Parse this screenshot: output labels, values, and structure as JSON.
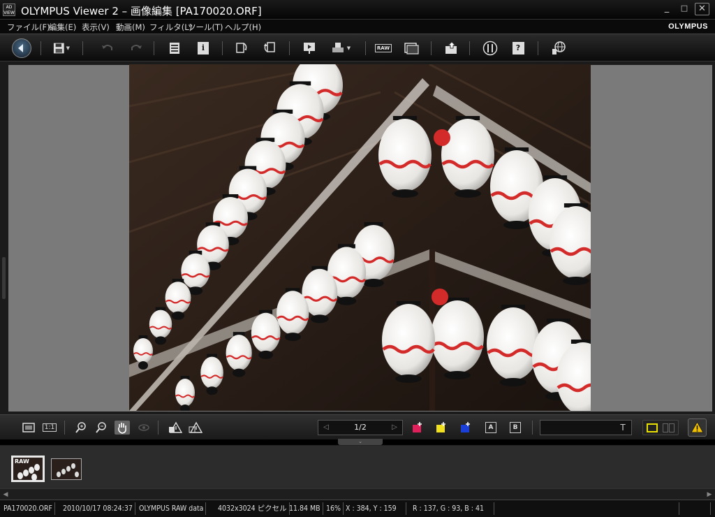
{
  "window": {
    "title": "OLYMPUS Viewer 2 – 画像編集 [PA170020.ORF]",
    "app_icon_text": "AD VIEW",
    "controls": {
      "minimize": "_",
      "maximize": "□",
      "close": "✕"
    }
  },
  "menu": {
    "items": [
      "ファイル(F)",
      "編集(E)",
      "表示(V)",
      "動画(M)",
      "フィルタ(L)",
      "ツール(T)",
      "ヘルプ(H)"
    ],
    "brand": "OLYMPUS"
  },
  "toolbar": {
    "buttons": [
      {
        "name": "back-button",
        "icon": "arrow-left-circle-icon"
      },
      {
        "name": "save-button",
        "icon": "floppy-icon"
      },
      {
        "name": "undo-button",
        "icon": "undo-icon"
      },
      {
        "name": "redo-button",
        "icon": "redo-icon"
      },
      {
        "name": "list-button",
        "icon": "list-icon"
      },
      {
        "name": "info-button",
        "icon": "info-icon",
        "label": "i"
      },
      {
        "name": "rotate-button",
        "icon": "rotate-icon"
      },
      {
        "name": "transform-button",
        "icon": "transform-icon"
      },
      {
        "name": "slideshow-button",
        "icon": "slideshow-icon"
      },
      {
        "name": "print-button",
        "icon": "printer-icon"
      },
      {
        "name": "raw-develop-button",
        "icon": "raw-icon",
        "label": "RAW"
      },
      {
        "name": "batch-raw-button",
        "icon": "batch-raw-icon"
      },
      {
        "name": "export-button",
        "icon": "export-icon"
      },
      {
        "name": "settings-button",
        "icon": "tools-icon"
      },
      {
        "name": "help-button",
        "icon": "help-icon",
        "label": "?"
      },
      {
        "name": "web-button",
        "icon": "globe-icon"
      }
    ]
  },
  "viewer": {
    "page_indicator": "1/2",
    "text_field_value": ""
  },
  "filmstrip": {
    "thumbnails": [
      {
        "tag": "RAW",
        "selected": true
      },
      {
        "tag": "",
        "selected": false
      }
    ]
  },
  "status": {
    "filename": "PA170020.ORF",
    "datetime": "2010/10/17 08:24:37",
    "format": "OLYMPUS RAW data",
    "dimensions": "4032x3024 ピクセル",
    "filesize": "11.84 MB",
    "zoom": "16%",
    "coords": "X : 384, Y : 159",
    "rgb": "R : 137, G : 93, B : 41"
  },
  "colors": {
    "bg": "#000000",
    "canvas": "#7a7a7a",
    "lantern_red": "#d32a2a"
  }
}
